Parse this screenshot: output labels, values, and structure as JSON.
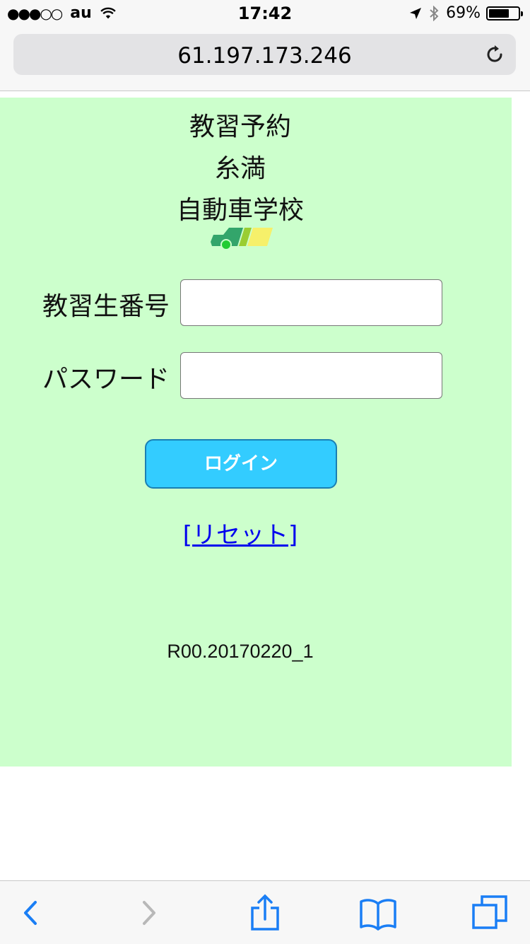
{
  "status_bar": {
    "signal_dots": "●●●○○",
    "carrier": "au",
    "time": "17:42",
    "battery_text": "69%",
    "battery_level": 0.69
  },
  "browser": {
    "url": "61.197.173.246"
  },
  "page": {
    "title_line1": "教習予約",
    "title_line2": "糸満",
    "title_line3": "自動車学校",
    "student_number_label": "教習生番号",
    "student_number_value": "",
    "password_label": "パスワード",
    "password_value": "",
    "login_button": "ログイン",
    "reset_link": "[リセット]",
    "version": "R00.20170220_1"
  },
  "colors": {
    "background": "#ccffcc",
    "button": "#33ccff",
    "link": "#0000ee",
    "ios_blue": "#1a7ef5"
  }
}
